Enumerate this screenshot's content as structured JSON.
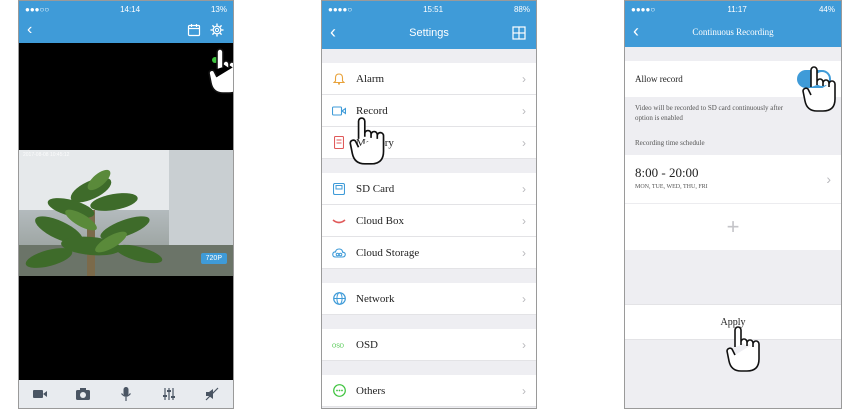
{
  "phone1": {
    "status": {
      "carrier": "●●●○○",
      "time": "14:14",
      "battery": "13%"
    },
    "video": {
      "timestamp": "2017-08-08 10:45:12",
      "quality": "720P"
    },
    "toolbar": [
      "camera-icon",
      "snapshot-icon",
      "microphone-icon",
      "equalizer-icon",
      "mute-icon"
    ]
  },
  "phone2": {
    "status": {
      "carrier": "●●●●○",
      "time": "15:51",
      "battery": "88%"
    },
    "title": "Settings",
    "groups": [
      [
        {
          "label": "Alarm",
          "icon": "bell-icon",
          "color": "#e8a23a"
        },
        {
          "label": "Record",
          "icon": "record-icon",
          "color": "#3f9bd8"
        },
        {
          "label": "Memory",
          "icon": "memory-icon",
          "color": "#e05a5a"
        }
      ],
      [
        {
          "label": "SD Card",
          "icon": "sd-card-icon",
          "color": "#3f9bd8"
        },
        {
          "label": "Cloud Box",
          "icon": "cloud-box-icon",
          "color": "#e05a5a"
        },
        {
          "label": "Cloud Storage",
          "icon": "cloud-storage-icon",
          "color": "#3f9bd8"
        }
      ],
      [
        {
          "label": "Network",
          "icon": "globe-icon",
          "color": "#3f9bd8"
        }
      ],
      [
        {
          "label": "OSD",
          "icon": "osd-icon",
          "color": "#3ec33e"
        }
      ],
      [
        {
          "label": "Others",
          "icon": "others-icon",
          "color": "#3ec33e"
        }
      ]
    ]
  },
  "phone3": {
    "status": {
      "carrier": "●●●●○",
      "time": "11:17",
      "battery": "44%"
    },
    "title": "Continuous Recording",
    "allow_record_label": "Allow record",
    "allow_record_on": true,
    "note": "Video will be recorded to SD card continuously after option is enabled",
    "schedule_label": "Recording time schedule",
    "schedule_time": "8:00 - 20:00",
    "schedule_days": "MON, TUE, WED, THU, FRI",
    "apply_label": "Apply"
  },
  "colors": {
    "accent": "#3f9bd8"
  }
}
